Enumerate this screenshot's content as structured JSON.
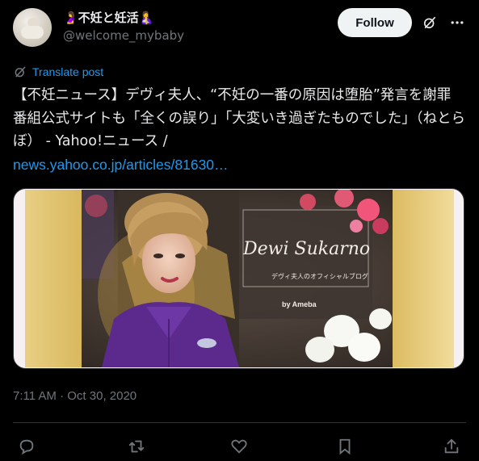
{
  "author": {
    "display_name": "🤰不妊と妊活🤱",
    "handle": "@welcome_mybaby"
  },
  "follow_button": "Follow",
  "translate_label": "Translate post",
  "tweet": {
    "text": "【不妊ニュース】デヴィ夫人、“不妊の一番の原因は堕胎”発言を謝罪 番組公式サイトも「全くの誤り」「大変いき過ぎたものでした」（ねとらぼ） - Yahoo!ニュース /",
    "link": "news.yahoo.co.jp/articles/81630…"
  },
  "media": {
    "signature": "Dewi Sukarno",
    "subtitle": "デヴィ夫人のオフィシャルブログ",
    "by": "by Ameba"
  },
  "timestamp": "7:11 AM · Oct 30, 2020",
  "icons": {
    "grok": "grok-icon",
    "more": "more-icon",
    "translate": "translate-icon",
    "reply": "reply-icon",
    "repost": "repost-icon",
    "like": "like-icon",
    "bookmark": "bookmark-icon",
    "share": "share-icon"
  },
  "colors": {
    "background": "#000000",
    "text": "#e7e9ea",
    "muted": "#71767b",
    "accent": "#1d9bf0",
    "border": "#2f3336"
  }
}
